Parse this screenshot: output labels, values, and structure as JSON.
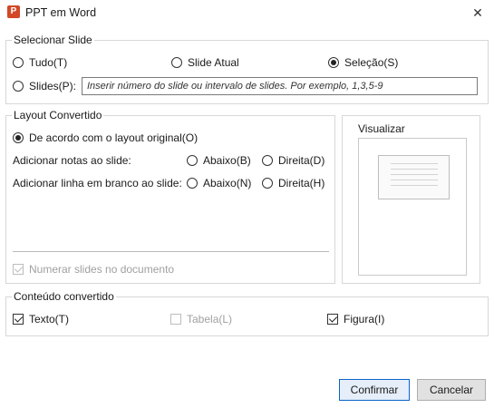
{
  "window": {
    "title": "PPT em Word",
    "app_icon_letter": "P",
    "close_glyph": "✕",
    "accent_color": "#d24726"
  },
  "select_slide": {
    "legend": "Selecionar Slide",
    "options": {
      "all": "Tudo(T)",
      "current": "Slide Atual",
      "selection": "Seleção(S)",
      "slides": "Slides(P):"
    },
    "selected": "selection",
    "slides_placeholder": "Inserir número do slide ou intervalo de slides. Por exemplo, 1,3,5-9"
  },
  "layout": {
    "legend": "Layout Convertido",
    "original_layout": "De acordo com o layout original(O)",
    "add_notes_label": "Adicionar notas ao slide:",
    "add_blank_line_label": "Adicionar linha em branco ao slide:",
    "below_b": "Abaixo(B)",
    "right_d": "Direita(D)",
    "below_n": "Abaixo(N)",
    "right_h": "Direita(H)",
    "number_slides": "Numerar slides no documento"
  },
  "preview": {
    "label": "Visualizar"
  },
  "content": {
    "legend": "Conteúdo convertido",
    "text": "Texto(T)",
    "table": "Tabela(L)",
    "figure": "Figura(I)"
  },
  "buttons": {
    "confirm": "Confirmar",
    "cancel": "Cancelar"
  }
}
